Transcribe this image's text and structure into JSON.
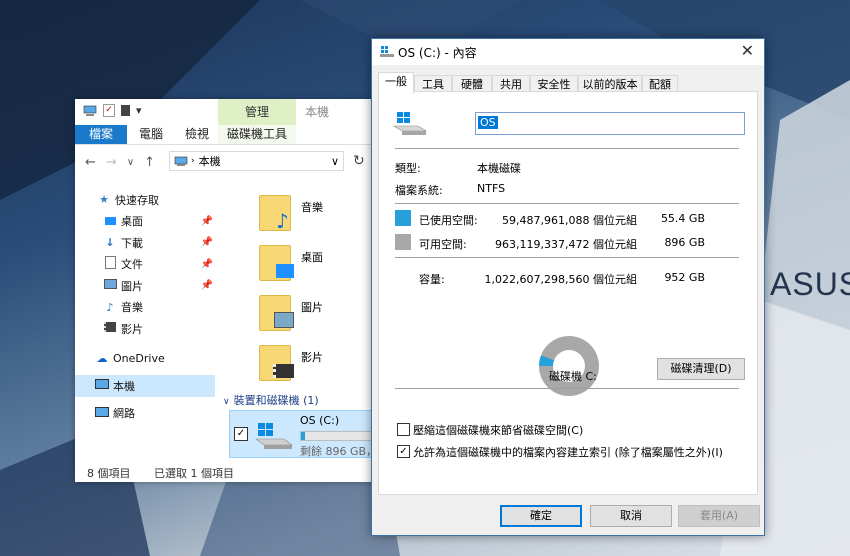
{
  "desktop": {
    "brand_text": "ASUS"
  },
  "explorer": {
    "manage_tab": "管理",
    "title": "本機",
    "ribbon": {
      "file": "檔案",
      "computer": "電腦",
      "view": "檢視",
      "disk_tools": "磁碟機工具"
    },
    "address": {
      "path": "本機"
    },
    "nav": [
      {
        "label": "快速存取",
        "icon": "star-icon"
      },
      {
        "label": "桌面",
        "icon": "desktop-icon",
        "pinned": true
      },
      {
        "label": "下載",
        "icon": "download-icon",
        "pinned": true
      },
      {
        "label": "文件",
        "icon": "document-icon",
        "pinned": true
      },
      {
        "label": "圖片",
        "icon": "picture-icon",
        "pinned": true
      },
      {
        "label": "音樂",
        "icon": "music-icon"
      },
      {
        "label": "影片",
        "icon": "video-icon"
      },
      {
        "label": "OneDrive",
        "icon": "cloud-icon"
      },
      {
        "label": "本機",
        "icon": "computer-icon",
        "selected": true
      },
      {
        "label": "網路",
        "icon": "network-icon"
      }
    ],
    "folders": [
      {
        "label": "音樂"
      },
      {
        "label": "桌面"
      },
      {
        "label": "圖片"
      },
      {
        "label": "影片"
      }
    ],
    "devices_group": "裝置和磁碟機 (1)",
    "drive": {
      "name": "OS (C:)",
      "free_text": "剩餘 896 GB，",
      "used_fraction": 0.058,
      "checked": true
    },
    "status": {
      "items": "8 個項目",
      "selected": "已選取 1 個項目"
    }
  },
  "dialog": {
    "title": "OS (C:) - 內容",
    "tabs": [
      "一般",
      "工具",
      "硬體",
      "共用",
      "安全性",
      "以前的版本",
      "配額"
    ],
    "active_tab": "一般",
    "name_value": "OS",
    "type_label": "類型:",
    "type_value": "本機磁碟",
    "fs_label": "檔案系統:",
    "fs_value": "NTFS",
    "used": {
      "label": "已使用空間:",
      "bytes": "59,487,961,088 個位元組",
      "size": "55.4 GB",
      "color": "#26a0da"
    },
    "free": {
      "label": "可用空間:",
      "bytes": "963,119,337,472 個位元組",
      "size": "896 GB",
      "color": "#a8a8a8"
    },
    "capacity": {
      "label": "容量:",
      "bytes": "1,022,607,298,560 個位元組",
      "size": "952 GB"
    },
    "used_fraction": 0.058,
    "drive_label": "磁碟機 C:",
    "cleanup_button": "磁碟清理(D)",
    "compress_option": {
      "label": "壓縮這個磁碟機來節省磁碟空間(C)",
      "checked": false
    },
    "index_option": {
      "label": "允許為這個磁碟機中的檔案內容建立索引 (除了檔案屬性之外)(I)",
      "checked": true
    },
    "buttons": {
      "ok": "確定",
      "cancel": "取消",
      "apply": "套用(A)"
    }
  }
}
